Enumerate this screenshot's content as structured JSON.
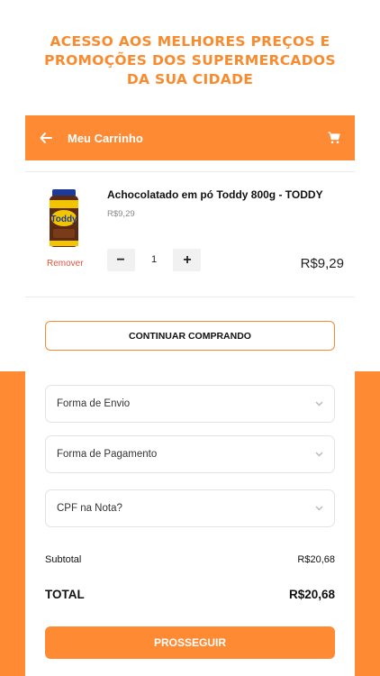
{
  "promo": {
    "line1": "ACESSO AOS MELHORES PREÇOS E",
    "line2": "PROMOÇÕES DOS SUPERMERCADOS",
    "line3": "DA SUA CIDADE"
  },
  "appbar": {
    "title": "Meu Carrinho",
    "back_icon": "arrow-left-icon",
    "cart_icon": "shopping-cart-icon"
  },
  "cart_item": {
    "name": "Achocolatado em pó Toddy 800g - TODDY",
    "unit_price": "R$9,29",
    "quantity": "1",
    "decrement": "−",
    "increment": "+",
    "total": "R$9,29",
    "remove_label": "Remover",
    "image_brand": "Toddy"
  },
  "continue_label": "CONTINUAR COMPRANDO",
  "selects": {
    "shipping": "Forma de Envio",
    "payment": "Forma de Pagamento",
    "cpf": "CPF na Nota?"
  },
  "summary": {
    "subtotal_label": "Subtotal",
    "subtotal_value": "R$20,68",
    "total_label": "TOTAL",
    "total_value": "R$20,68"
  },
  "proceed_label": "PROSSEGUIR",
  "colors": {
    "accent": "#fe8a33",
    "headline": "#f98b2f",
    "remove": "#e2533a"
  }
}
